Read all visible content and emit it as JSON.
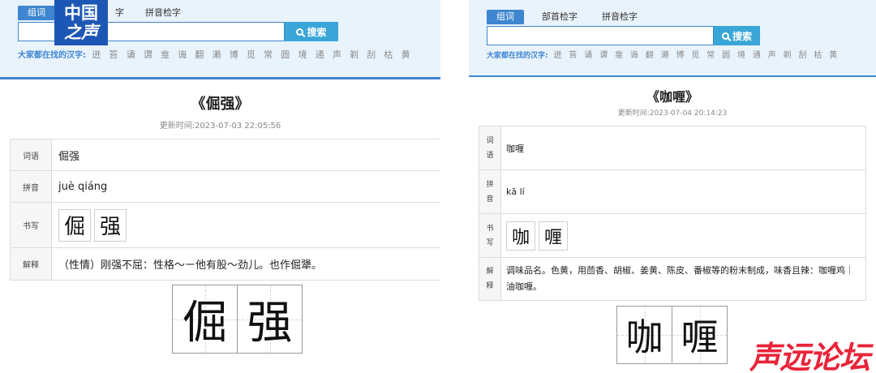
{
  "left": {
    "tabs": [
      "组词",
      "字",
      "拼音检字"
    ],
    "search": {
      "value": "",
      "button_label": "搜索"
    },
    "hot": {
      "label": "大家都在找的汉字:",
      "chars": [
        "迸",
        "笞",
        "诵",
        "谓",
        "龛",
        "诲",
        "翻",
        "濑",
        "博",
        "觅",
        "常",
        "圆",
        "境",
        "通",
        "声",
        "剃",
        "刮",
        "枯",
        "黄"
      ]
    },
    "title": "《倔强》",
    "updated": "更新时间:2023-07-03 22:05:56",
    "rows": {
      "ci_label": "词语",
      "ci_value": "倔强",
      "py_label": "拼音",
      "py_value": "juè qiáng",
      "sx_label": "书写",
      "sx_chars": [
        "倔",
        "强"
      ],
      "js_label": "解释",
      "js_value": "（性情）刚强不屈：性格～ㄧ他有股～劲儿。也作倔犟。"
    },
    "big_chars": [
      "倔",
      "强"
    ],
    "logo_line1": "中国",
    "logo_line2": "之声"
  },
  "right": {
    "tabs": [
      "组词",
      "部首检字",
      "拼音检字"
    ],
    "search": {
      "value": "",
      "button_label": "搜索"
    },
    "hot": {
      "label": "大家都在找的汉字:",
      "chars": [
        "迸",
        "笞",
        "诵",
        "谓",
        "龛",
        "诲",
        "翻",
        "濑",
        "博",
        "觅",
        "常",
        "圆",
        "境",
        "通",
        "声",
        "剃",
        "刮",
        "枯",
        "黄"
      ]
    },
    "title": "《咖喱》",
    "updated": "更新时间:2023-07-04 20:14:23",
    "rows": {
      "ci_label": "词语",
      "ci_value": "咖喱",
      "py_label": "拼音",
      "py_value": "kā lí",
      "sx_label": "书写",
      "sx_chars": [
        "咖",
        "喱"
      ],
      "js_label": "解释",
      "js_value": "调味品名。色黄，用茴香、胡椒、姜黄、陈皮、番椒等的粉末制成，味香且辣：咖喱鸡｜油咖喱。"
    },
    "big_chars": [
      "咖",
      "喱"
    ],
    "watermark": "声远论坛"
  }
}
